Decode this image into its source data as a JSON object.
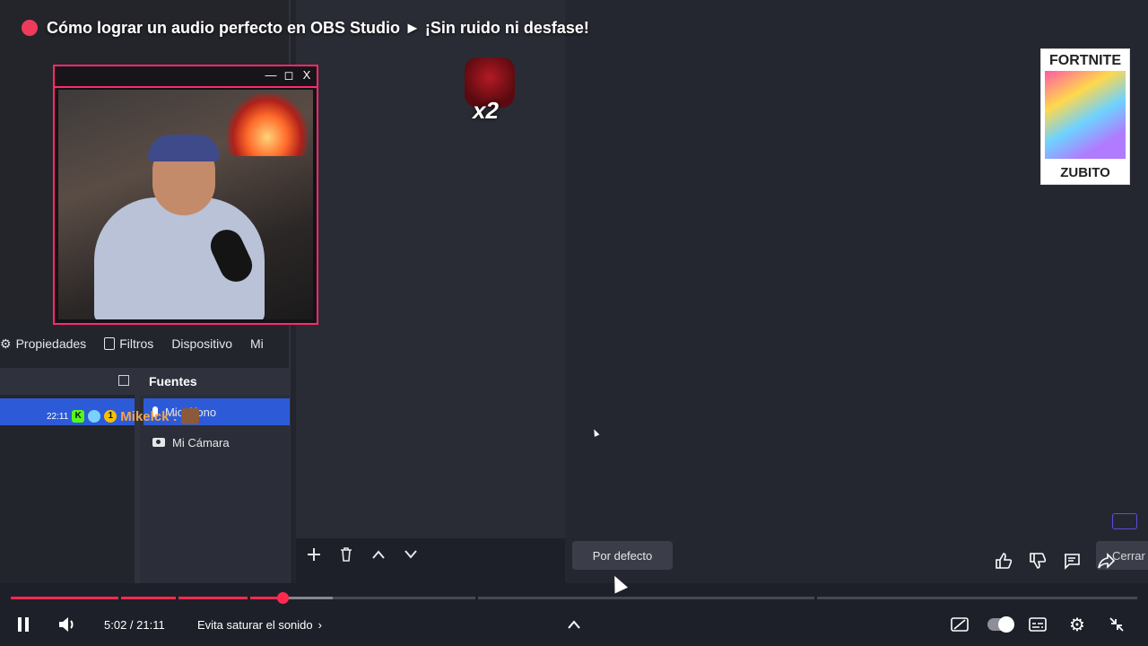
{
  "video": {
    "title": "Cómo lograr un audio perfecto en OBS Studio ► ¡Sin ruido ni desfase!"
  },
  "webcam_window": {
    "controls": [
      "—",
      "◻",
      "X"
    ]
  },
  "badge_overlay": {
    "multiplier": "x2"
  },
  "promo_card": {
    "title": "FORTNITE",
    "code": "ZUBITO"
  },
  "obs_toolbar": {
    "properties": "Propiedades",
    "filters": "Filtros",
    "device": "Dispositivo",
    "more": "Mi"
  },
  "chat": {
    "time": "22:11",
    "username": "Mikelck :"
  },
  "sources": {
    "header": "Fuentes",
    "items": [
      {
        "label": "Micrófono"
      },
      {
        "label": "Mi Cámara"
      }
    ]
  },
  "tooltip": {
    "text": "Por defecto"
  },
  "yt_side": {
    "close_label": "Cerrar"
  },
  "player": {
    "time": "5:02 / 21:11",
    "chapter": "Evita saturar el sonido",
    "progress_played": 0.2416,
    "progress_buffered": 0.2855
  }
}
